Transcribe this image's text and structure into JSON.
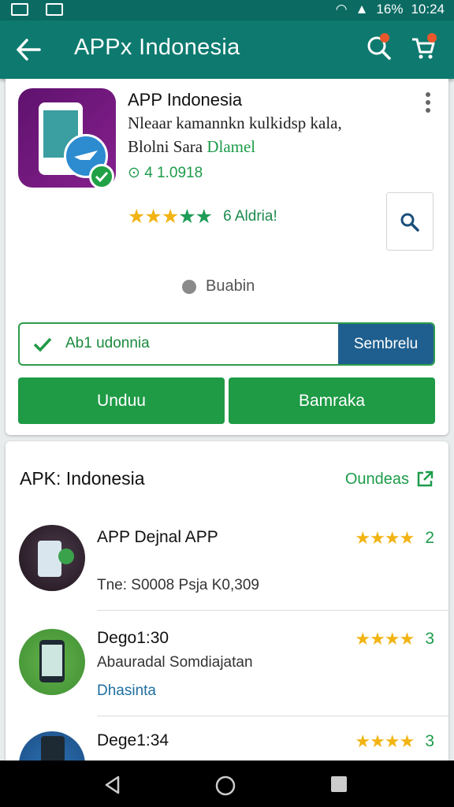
{
  "status_bar": {
    "battery": "16%",
    "time": "10:24"
  },
  "app_bar": {
    "title": "APPx Indonesia"
  },
  "app_card": {
    "name": "APP Indonesia",
    "description_line1": "Nleaar kamannkn kulkidsp kala,",
    "description_line2": "Blolni Sara",
    "description_link": "Dlamel",
    "version": "4 1.0918",
    "rating_count": "6 Aldria!",
    "loading_text": "Buabin",
    "status_pill_label": "Ab1 udonnia",
    "status_pill_button": "Sembrelu",
    "download_label": "Unduu",
    "secondary_label": "Bamraka"
  },
  "list_section": {
    "title": "APK: Indonesia",
    "see_all": "Oundeas",
    "items": [
      {
        "title": "APP Dejnal APP",
        "subtitle": "Tne: S0008 Psja K0,309",
        "extra": "",
        "rating": "2"
      },
      {
        "title": "Dego1:30",
        "subtitle": "Abauradal Somdiajatan",
        "extra": "Dhasinta",
        "rating": "3"
      },
      {
        "title": "Dege1:34",
        "subtitle": "",
        "extra": "",
        "rating": "3"
      }
    ]
  },
  "colors": {
    "primary": "#0e7a6f",
    "accent_green": "#1f9a45",
    "star": "#f2b414",
    "blue_button": "#1f5f8f"
  },
  "icons": [
    "back-arrow-icon",
    "search-icon",
    "cart-icon",
    "more-vert-icon",
    "check-icon",
    "external-link-icon",
    "nav-back-icon",
    "nav-home-icon",
    "nav-recents-icon"
  ]
}
